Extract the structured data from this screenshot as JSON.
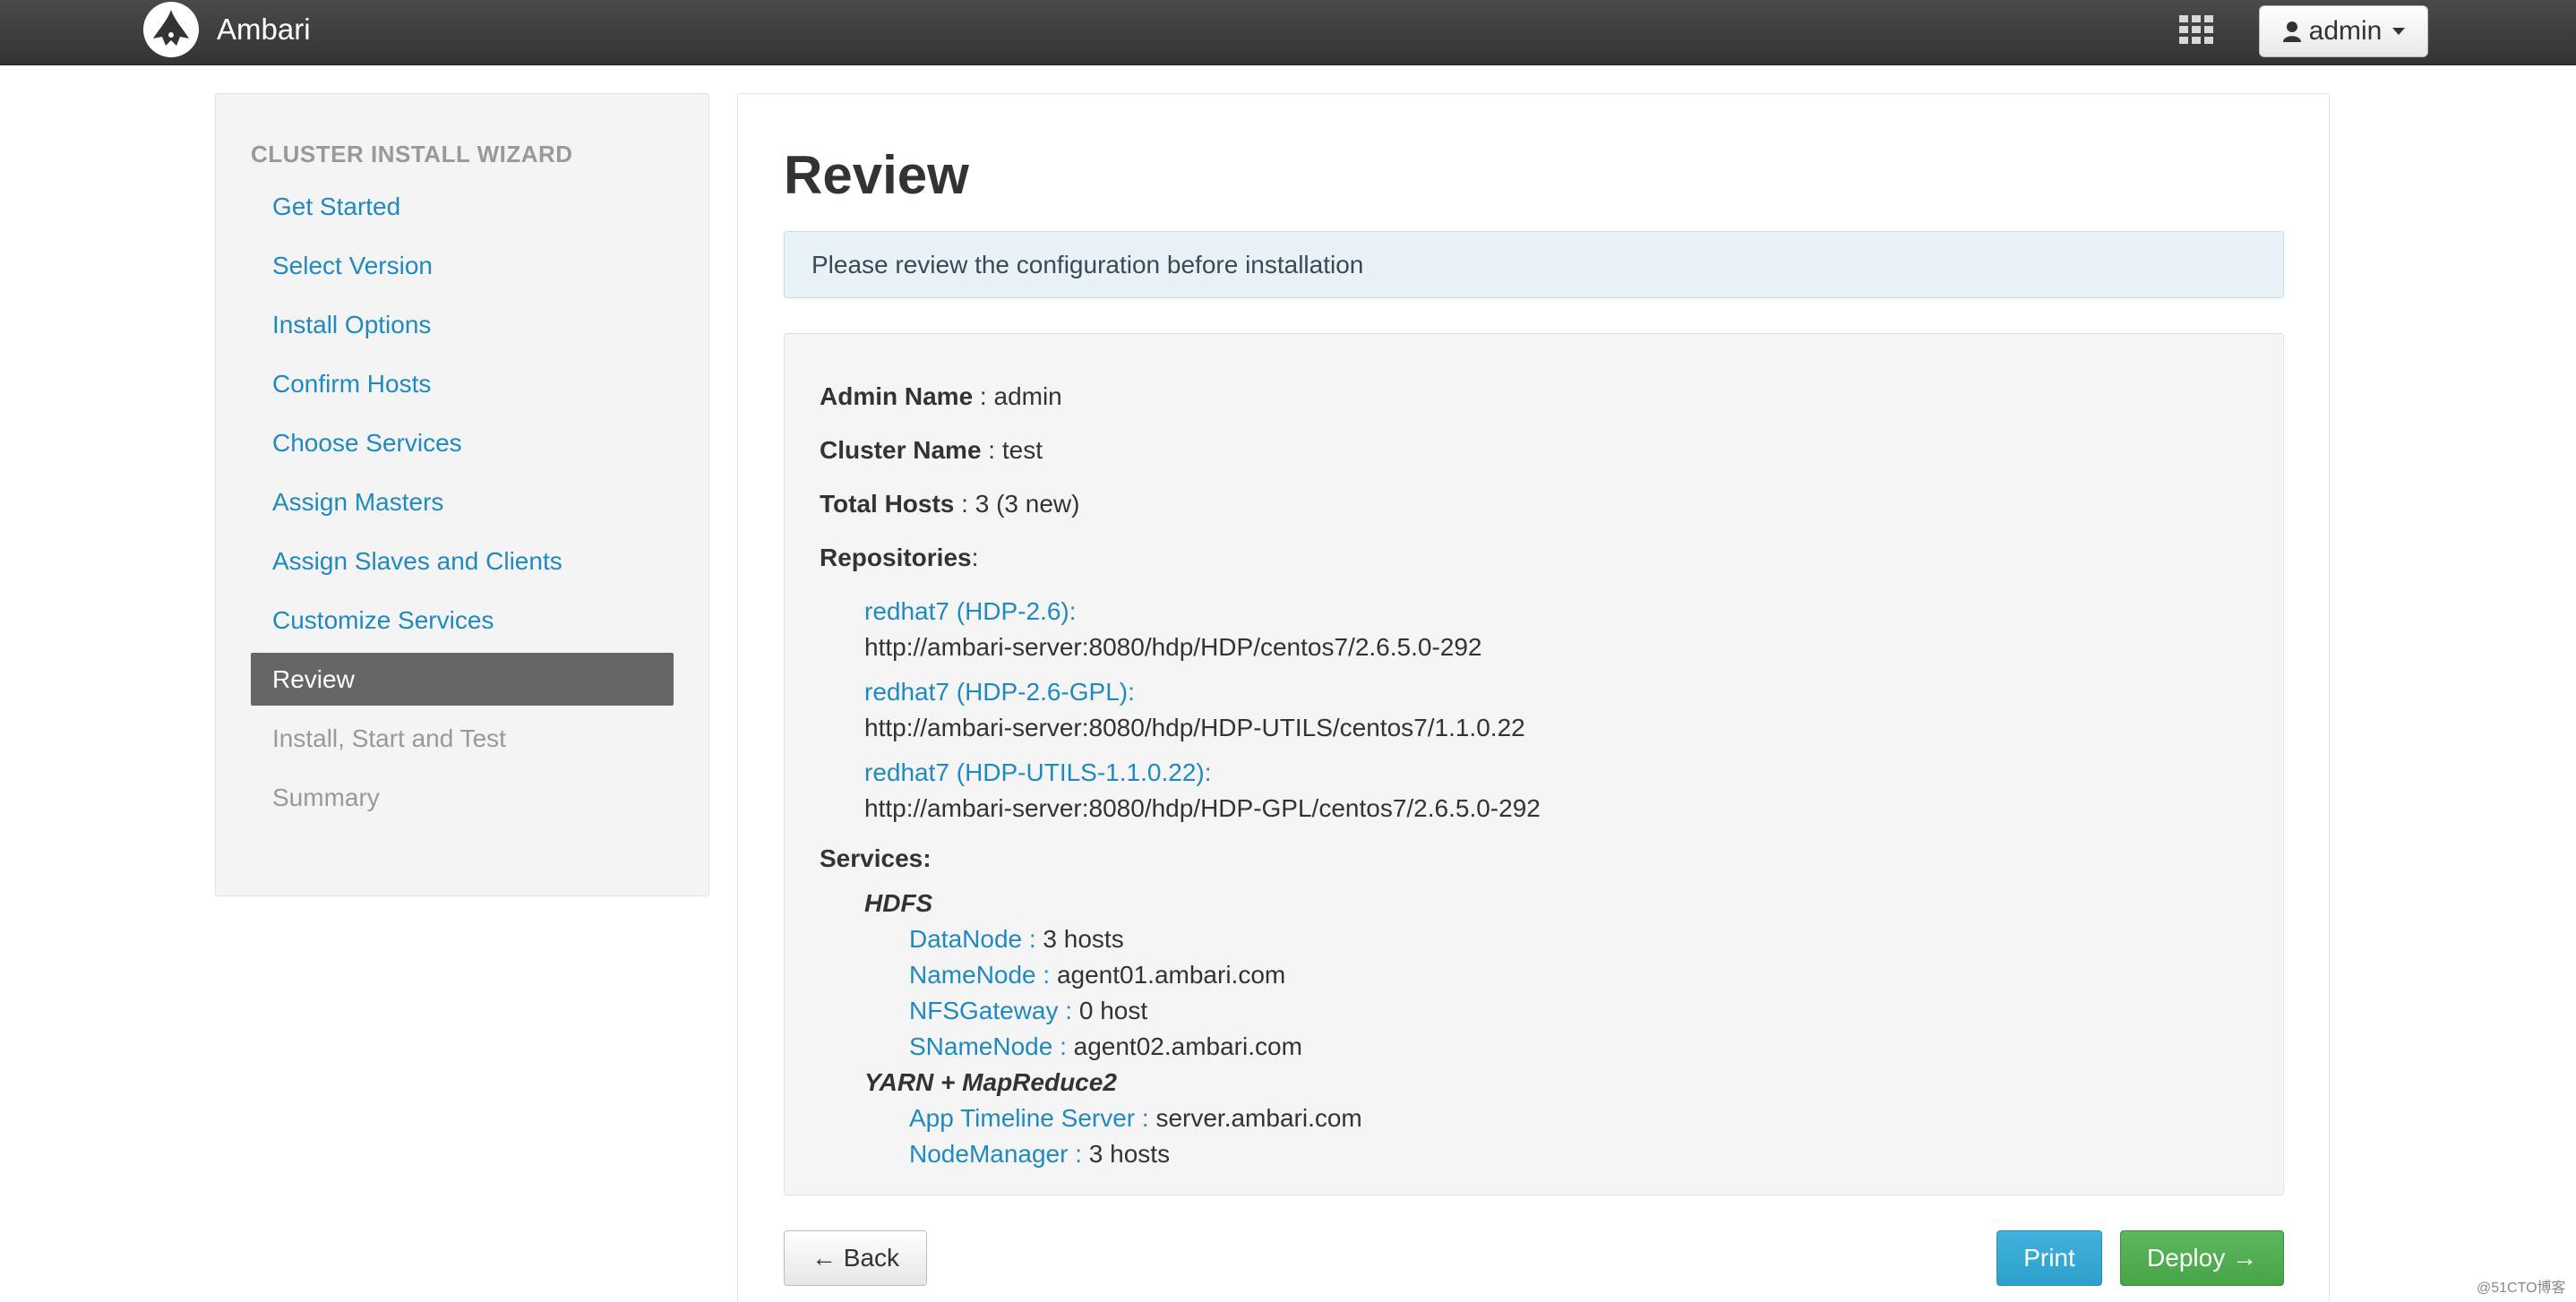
{
  "header": {
    "brand": "Ambari",
    "user": "admin"
  },
  "sidebar": {
    "title": "CLUSTER INSTALL WIZARD",
    "items": [
      {
        "label": "Get Started",
        "state": "done"
      },
      {
        "label": "Select Version",
        "state": "done"
      },
      {
        "label": "Install Options",
        "state": "done"
      },
      {
        "label": "Confirm Hosts",
        "state": "done"
      },
      {
        "label": "Choose Services",
        "state": "done"
      },
      {
        "label": "Assign Masters",
        "state": "done"
      },
      {
        "label": "Assign Slaves and Clients",
        "state": "done"
      },
      {
        "label": "Customize Services",
        "state": "done"
      },
      {
        "label": "Review",
        "state": "active"
      },
      {
        "label": "Install, Start and Test",
        "state": "disabled"
      },
      {
        "label": "Summary",
        "state": "disabled"
      }
    ]
  },
  "main": {
    "title": "Review",
    "alert": "Please review the configuration before installation",
    "admin_label": "Admin Name",
    "admin_value": " : admin",
    "cluster_label": "Cluster Name",
    "cluster_value": " : test",
    "hosts_label": "Total Hosts",
    "hosts_value": " : 3 (3 new)",
    "repos_label": "Repositories",
    "repos_suffix": ":",
    "repos": [
      {
        "name": "redhat7 (HDP-2.6):",
        "url": "http://ambari-server:8080/hdp/HDP/centos7/2.6.5.0-292"
      },
      {
        "name": "redhat7 (HDP-2.6-GPL):",
        "url": "http://ambari-server:8080/hdp/HDP-UTILS/centos7/1.1.0.22"
      },
      {
        "name": "redhat7 (HDP-UTILS-1.1.0.22):",
        "url": "http://ambari-server:8080/hdp/HDP-GPL/centos7/2.6.5.0-292"
      }
    ],
    "services_label": "Services:",
    "services": [
      {
        "name": "HDFS",
        "components": [
          {
            "key": "DataNode : ",
            "value": "3 hosts"
          },
          {
            "key": "NameNode : ",
            "value": "agent01.ambari.com"
          },
          {
            "key": "NFSGateway : ",
            "value": "0 host"
          },
          {
            "key": "SNameNode : ",
            "value": "agent02.ambari.com"
          }
        ]
      },
      {
        "name": "YARN + MapReduce2",
        "components": [
          {
            "key": "App Timeline Server : ",
            "value": "server.ambari.com"
          },
          {
            "key": "NodeManager : ",
            "value": "3 hosts"
          }
        ]
      }
    ]
  },
  "buttons": {
    "back": "← Back",
    "print": "Print",
    "deploy": "Deploy →"
  },
  "watermark": "@51CTO博客",
  "colors": {
    "link": "#1f8ac0",
    "active_step": "#666666",
    "deploy": "#5cb85c",
    "print": "#3fb3dd"
  }
}
